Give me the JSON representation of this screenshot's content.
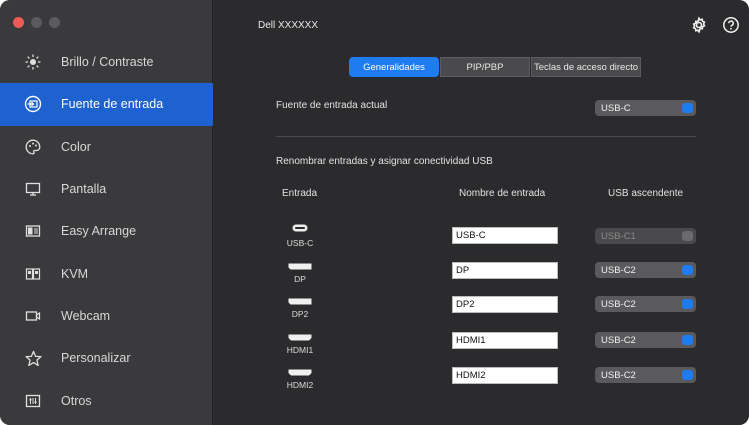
{
  "window": {
    "title": "Dell XXXXXX"
  },
  "sidebar": {
    "items": [
      {
        "label": "Brillo / Contraste",
        "icon": "sun-icon",
        "active": false
      },
      {
        "label": "Fuente de entrada",
        "icon": "input-source-icon",
        "active": true
      },
      {
        "label": "Color",
        "icon": "palette-icon",
        "active": false
      },
      {
        "label": "Pantalla",
        "icon": "monitor-icon",
        "active": false
      },
      {
        "label": "Easy Arrange",
        "icon": "easy-arrange-icon",
        "active": false
      },
      {
        "label": "KVM",
        "icon": "kvm-icon",
        "active": false
      },
      {
        "label": "Webcam",
        "icon": "webcam-icon",
        "active": false
      },
      {
        "label": "Personalizar",
        "icon": "star-icon",
        "active": false
      },
      {
        "label": "Otros",
        "icon": "others-icon",
        "active": false
      }
    ]
  },
  "tabs": [
    {
      "label": "Generalidades",
      "active": true
    },
    {
      "label": "PIP/PBP",
      "active": false
    },
    {
      "label": "Teclas de acceso directo",
      "active": false
    }
  ],
  "current_input": {
    "label": "Fuente de entrada actual",
    "value": "USB-C"
  },
  "rename_section": {
    "heading": "Renombrar entradas y asignar conectividad USB",
    "columns": {
      "input": "Entrada",
      "name": "Nombre de entrada",
      "usb": "USB ascendente"
    },
    "rows": [
      {
        "port": "USB-C",
        "icon": "usb-c-port-icon",
        "name": "USB-C",
        "usb": "USB-C1",
        "usb_disabled": true
      },
      {
        "port": "DP",
        "icon": "displayport-icon",
        "name": "DP",
        "usb": "USB-C2",
        "usb_disabled": false
      },
      {
        "port": "DP2",
        "icon": "displayport-icon",
        "name": "DP2",
        "usb": "USB-C2",
        "usb_disabled": false
      },
      {
        "port": "HDMI1",
        "icon": "hdmi-port-icon",
        "name": "HDMI1",
        "usb": "USB-C2",
        "usb_disabled": false
      },
      {
        "port": "HDMI2",
        "icon": "hdmi-port-icon",
        "name": "HDMI2",
        "usb": "USB-C2",
        "usb_disabled": false
      }
    ]
  },
  "colors": {
    "accent": "#1e62cf",
    "tab_accent": "#1e7bf0",
    "close": "#ee5b56"
  }
}
